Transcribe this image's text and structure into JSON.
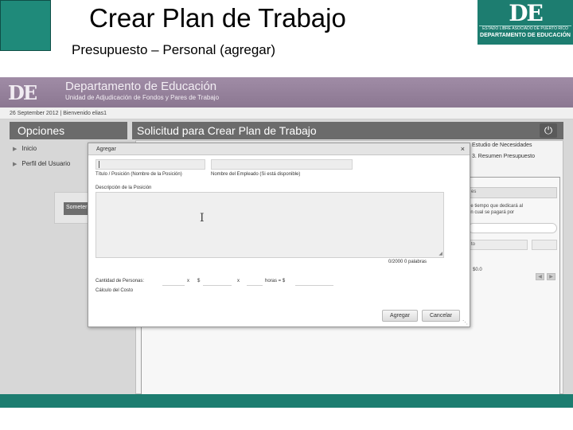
{
  "slide": {
    "title": "Crear Plan de Trabajo",
    "subtitle": "Presupuesto – Personal (agregar)",
    "logo": {
      "mark": "DE",
      "line1": "ESTADO LIBRE ASOCIADO DE PUERTO RICO",
      "line2": "DEPARTAMENTO DE EDUCACIÓN"
    }
  },
  "app": {
    "logo_mark": "DE",
    "department": "Departamento de Educación",
    "unit": "Unidad de Adjudicación de Fondos y Pares de Trabajo",
    "user_bar": "26 September 2012 | Bienvenido elias1"
  },
  "sidebar": {
    "heading": "Opciones",
    "items": [
      {
        "label": "Inicio"
      },
      {
        "label": "Perfil del Usuario"
      }
    ],
    "submit_button": "Someter"
  },
  "main": {
    "heading": "Solicitud para Crear Plan de Trabajo",
    "tabs_right": [
      "Estudio de Necesidades",
      "3. Resumen Presupuesto"
    ],
    "pill_text": "es",
    "help_text_1": "de tiempo que dedicará al",
    "help_text_2": "on cual se pagará por",
    "select_1": "to",
    "amount": "$0.0"
  },
  "modal": {
    "title": "Agregar",
    "close": "×",
    "label_title_position": "Título / Posición (Nombre de la Posición)",
    "label_employee_name": "Nombre del Empleado (Si está disponible)",
    "label_description": "Descripción de la Posición",
    "word_count": "0/2000 0 palabras",
    "label_quantity": "Cantidad de Personas:",
    "label_x1": "x",
    "label_dollar1": "$",
    "label_x2": "x",
    "label_hours": "horas = $",
    "label_cost_calc": "Cálculo del Costo",
    "btn_add": "Agregar",
    "btn_cancel": "Cancelar"
  },
  "colors": {
    "brand_teal": "#1d7d70",
    "header_purple": "#957f9b",
    "panel_gray": "#6b6b6b"
  },
  "icons": {
    "power": "power-icon",
    "cursor": "text-cursor-icon",
    "close": "close-icon"
  }
}
